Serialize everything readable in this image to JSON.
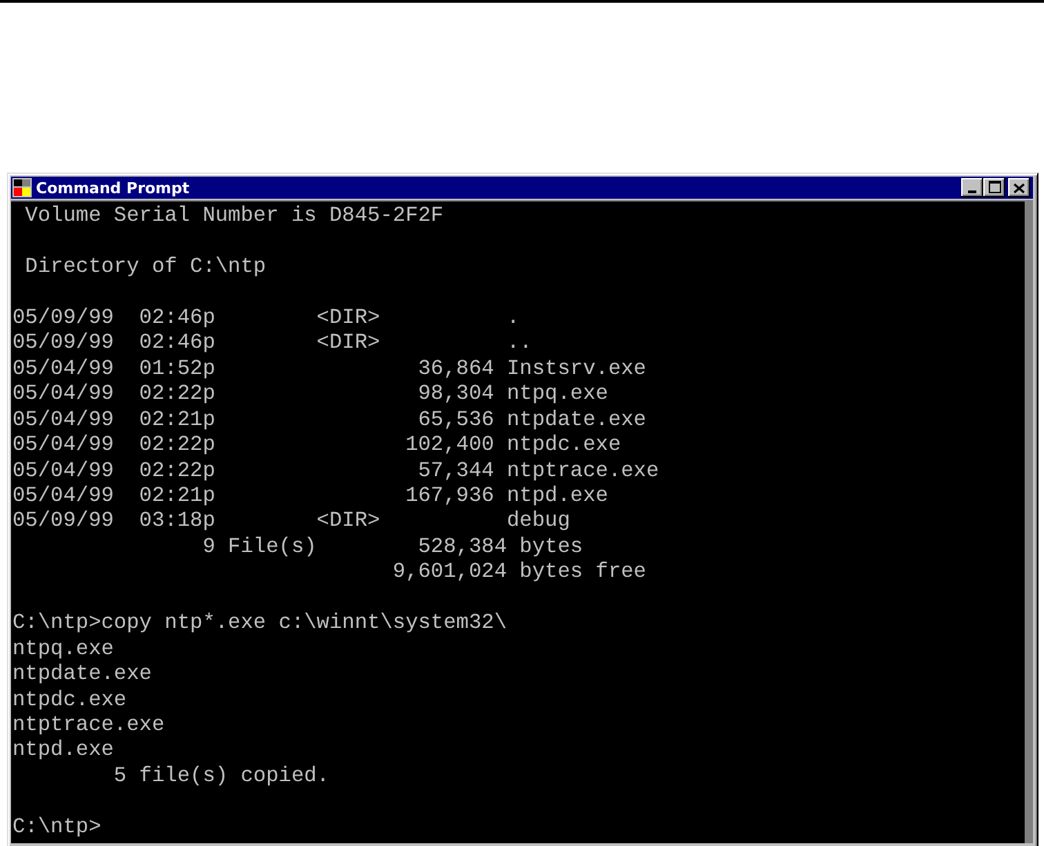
{
  "window": {
    "title": "Command Prompt",
    "controls": [
      {
        "kind": "minimize"
      },
      {
        "kind": "maximize"
      },
      {
        "kind": "close"
      }
    ]
  },
  "console": {
    "blocks": [
      [
        " Volume Serial Number is D845-2F2F"
      ],
      [
        " Directory of C:\\ntp"
      ],
      [
        "05/09/99  02:46p        <DIR>          .",
        "05/09/99  02:46p        <DIR>          ..",
        "05/04/99  01:52p                36,864 Instsrv.exe",
        "05/04/99  02:22p                98,304 ntpq.exe",
        "05/04/99  02:21p                65,536 ntpdate.exe",
        "05/04/99  02:22p               102,400 ntpdc.exe",
        "05/04/99  02:22p                57,344 ntptrace.exe",
        "05/04/99  02:21p               167,936 ntpd.exe",
        "05/09/99  03:18p        <DIR>          debug",
        "               9 File(s)        528,384 bytes",
        "                              9,601,024 bytes free"
      ],
      [
        "C:\\ntp>copy ntp*.exe c:\\winnt\\system32\\",
        "ntpq.exe",
        "ntpdate.exe",
        "ntpdc.exe",
        "ntptrace.exe",
        "ntpd.exe",
        "        5 file(s) copied."
      ],
      [
        "C:\\ntp>"
      ]
    ]
  }
}
